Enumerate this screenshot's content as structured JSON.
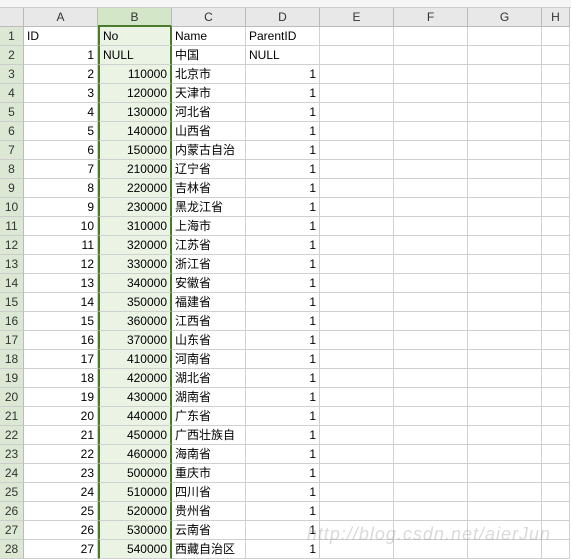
{
  "cell_ref": "B1",
  "columns": [
    "A",
    "B",
    "C",
    "D",
    "E",
    "F",
    "G",
    "H"
  ],
  "selected_col": "B",
  "headers": {
    "A": "ID",
    "B": "No",
    "C": "Name",
    "D": "ParentID"
  },
  "rows": [
    {
      "n": 1,
      "A": "ID",
      "B": "No",
      "C": "Name",
      "D": "ParentID"
    },
    {
      "n": 2,
      "A": "1",
      "B": "NULL",
      "C": "中国",
      "D": "NULL"
    },
    {
      "n": 3,
      "A": "2",
      "B": "110000",
      "C": "北京市",
      "D": "1"
    },
    {
      "n": 4,
      "A": "3",
      "B": "120000",
      "C": "天津市",
      "D": "1"
    },
    {
      "n": 5,
      "A": "4",
      "B": "130000",
      "C": "河北省",
      "D": "1"
    },
    {
      "n": 6,
      "A": "5",
      "B": "140000",
      "C": "山西省",
      "D": "1"
    },
    {
      "n": 7,
      "A": "6",
      "B": "150000",
      "C": "内蒙古自治",
      "D": "1"
    },
    {
      "n": 8,
      "A": "7",
      "B": "210000",
      "C": "辽宁省",
      "D": "1"
    },
    {
      "n": 9,
      "A": "8",
      "B": "220000",
      "C": "吉林省",
      "D": "1"
    },
    {
      "n": 10,
      "A": "9",
      "B": "230000",
      "C": "黑龙江省",
      "D": "1"
    },
    {
      "n": 11,
      "A": "10",
      "B": "310000",
      "C": "上海市",
      "D": "1"
    },
    {
      "n": 12,
      "A": "11",
      "B": "320000",
      "C": "江苏省",
      "D": "1"
    },
    {
      "n": 13,
      "A": "12",
      "B": "330000",
      "C": "浙江省",
      "D": "1"
    },
    {
      "n": 14,
      "A": "13",
      "B": "340000",
      "C": "安徽省",
      "D": "1"
    },
    {
      "n": 15,
      "A": "14",
      "B": "350000",
      "C": "福建省",
      "D": "1"
    },
    {
      "n": 16,
      "A": "15",
      "B": "360000",
      "C": "江西省",
      "D": "1"
    },
    {
      "n": 17,
      "A": "16",
      "B": "370000",
      "C": "山东省",
      "D": "1"
    },
    {
      "n": 18,
      "A": "17",
      "B": "410000",
      "C": "河南省",
      "D": "1"
    },
    {
      "n": 19,
      "A": "18",
      "B": "420000",
      "C": "湖北省",
      "D": "1"
    },
    {
      "n": 20,
      "A": "19",
      "B": "430000",
      "C": "湖南省",
      "D": "1"
    },
    {
      "n": 21,
      "A": "20",
      "B": "440000",
      "C": "广东省",
      "D": "1"
    },
    {
      "n": 22,
      "A": "21",
      "B": "450000",
      "C": "广西壮族自",
      "D": "1"
    },
    {
      "n": 23,
      "A": "22",
      "B": "460000",
      "C": "海南省",
      "D": "1"
    },
    {
      "n": 24,
      "A": "23",
      "B": "500000",
      "C": "重庆市",
      "D": "1"
    },
    {
      "n": 25,
      "A": "24",
      "B": "510000",
      "C": "四川省",
      "D": "1"
    },
    {
      "n": 26,
      "A": "25",
      "B": "520000",
      "C": "贵州省",
      "D": "1"
    },
    {
      "n": 27,
      "A": "26",
      "B": "530000",
      "C": "云南省",
      "D": "1"
    },
    {
      "n": 28,
      "A": "27",
      "B": "540000",
      "C": "西藏自治区",
      "D": "1"
    }
  ],
  "watermark": "http://blog.csdn.net/aierJun",
  "chart_data": {
    "type": "table",
    "columns": [
      "ID",
      "No",
      "Name",
      "ParentID"
    ],
    "rows": [
      [
        1,
        null,
        "中国",
        null
      ],
      [
        2,
        110000,
        "北京市",
        1
      ],
      [
        3,
        120000,
        "天津市",
        1
      ],
      [
        4,
        130000,
        "河北省",
        1
      ],
      [
        5,
        140000,
        "山西省",
        1
      ],
      [
        6,
        150000,
        "内蒙古自治",
        1
      ],
      [
        7,
        210000,
        "辽宁省",
        1
      ],
      [
        8,
        220000,
        "吉林省",
        1
      ],
      [
        9,
        230000,
        "黑龙江省",
        1
      ],
      [
        10,
        310000,
        "上海市",
        1
      ],
      [
        11,
        320000,
        "江苏省",
        1
      ],
      [
        12,
        330000,
        "浙江省",
        1
      ],
      [
        13,
        340000,
        "安徽省",
        1
      ],
      [
        14,
        350000,
        "福建省",
        1
      ],
      [
        15,
        360000,
        "江西省",
        1
      ],
      [
        16,
        370000,
        "山东省",
        1
      ],
      [
        17,
        410000,
        "河南省",
        1
      ],
      [
        18,
        420000,
        "湖北省",
        1
      ],
      [
        19,
        430000,
        "湖南省",
        1
      ],
      [
        20,
        440000,
        "广东省",
        1
      ],
      [
        21,
        450000,
        "广西壮族自",
        1
      ],
      [
        22,
        460000,
        "海南省",
        1
      ],
      [
        23,
        500000,
        "重庆市",
        1
      ],
      [
        24,
        510000,
        "四川省",
        1
      ],
      [
        25,
        520000,
        "贵州省",
        1
      ],
      [
        26,
        530000,
        "云南省",
        1
      ],
      [
        27,
        540000,
        "西藏自治区",
        1
      ]
    ]
  }
}
